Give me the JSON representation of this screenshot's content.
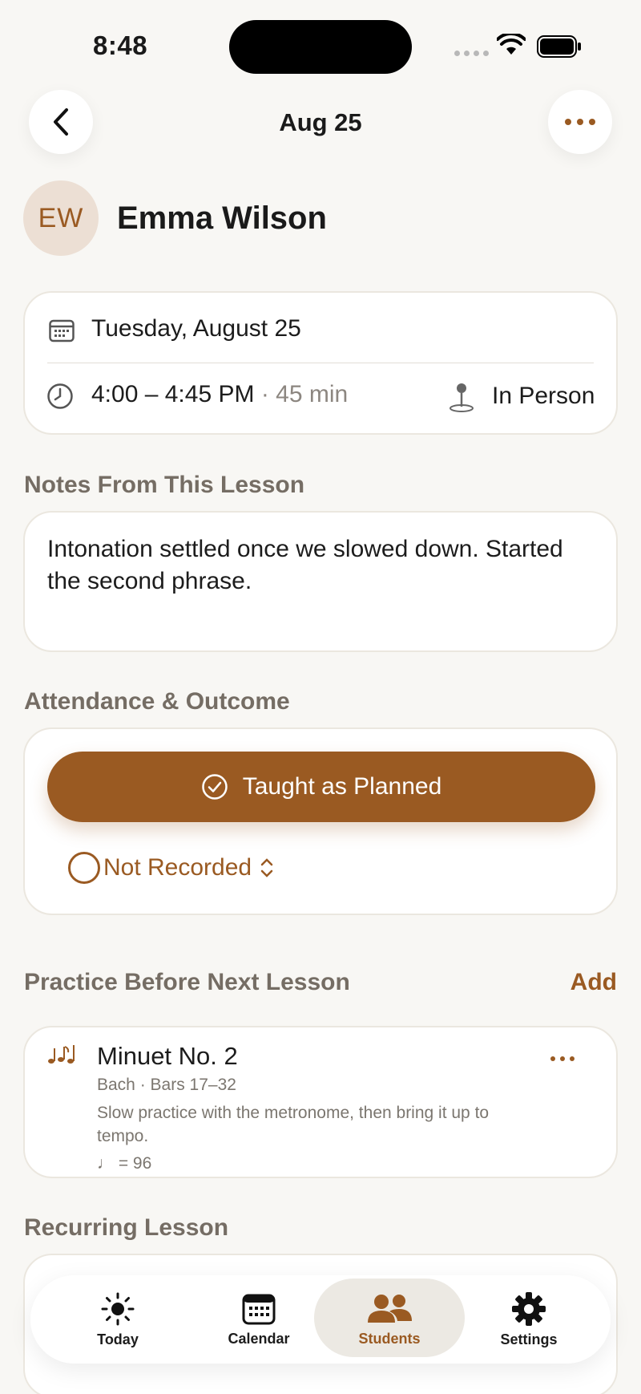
{
  "status_bar": {
    "time": "8:48"
  },
  "nav": {
    "title": "Aug 25"
  },
  "student": {
    "initials": "EW",
    "name": "Emma Wilson"
  },
  "lesson": {
    "date": "Tuesday, August 25",
    "time_range": "4:00 – 4:45 PM",
    "duration": "· 45 min",
    "location": "In Person"
  },
  "notes": {
    "heading": "Notes From This Lesson",
    "text": "Intonation settled once we slowed down. Started the second phrase."
  },
  "attendance": {
    "heading": "Attendance & Outcome",
    "primary_label": "Taught as Planned",
    "status_label": "Not Recorded"
  },
  "practice": {
    "heading": "Practice Before Next Lesson",
    "add_label": "Add",
    "items": [
      {
        "title": "Minuet No. 2",
        "subtitle": "Bach · Bars 17–32",
        "description": "Slow practice with the metronome, then bring it up to tempo.",
        "tempo": "♩ = 96"
      }
    ]
  },
  "recurring": {
    "heading": "Recurring Lesson"
  },
  "tabs": [
    {
      "label": "Today",
      "icon": "sun-icon"
    },
    {
      "label": "Calendar",
      "icon": "calendar-icon"
    },
    {
      "label": "Students",
      "icon": "people-icon",
      "active": true
    },
    {
      "label": "Settings",
      "icon": "gear-icon"
    }
  ],
  "colors": {
    "accent": "#9a5a22",
    "background": "#f8f7f4",
    "card": "#ffffff"
  }
}
